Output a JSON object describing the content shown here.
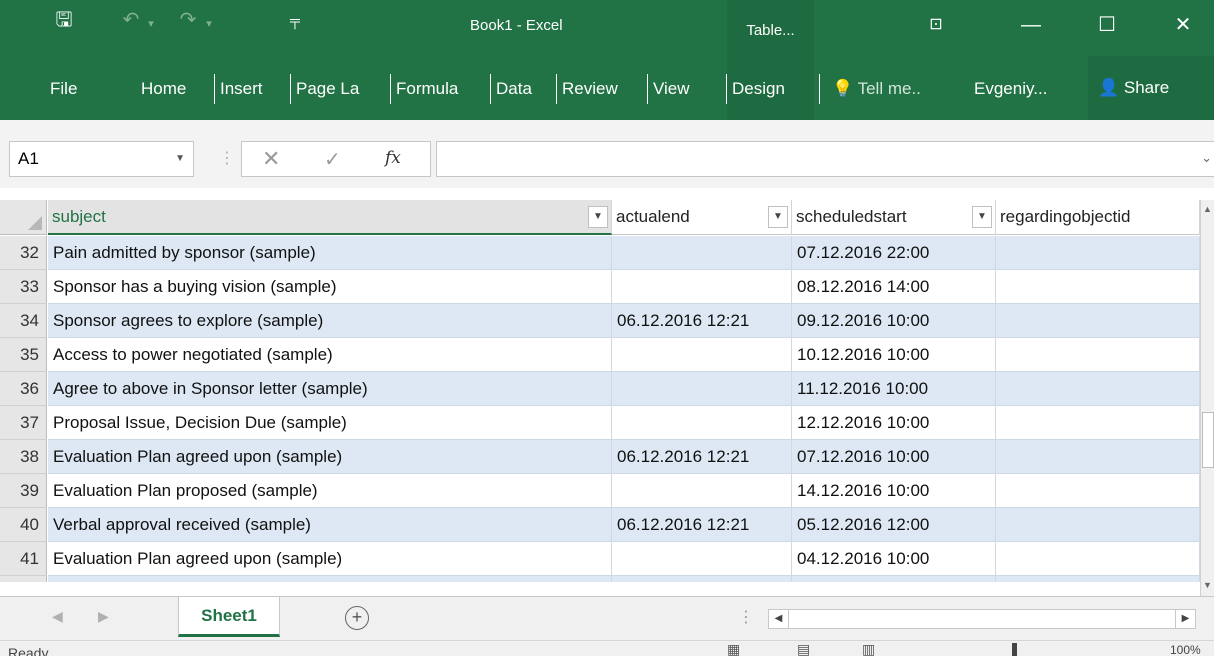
{
  "window": {
    "title": "Book1 - Excel",
    "context_tab": "Table...",
    "controls": {
      "ribbon_display": "⊡",
      "minimize": "—",
      "maximize": "☐",
      "close": "✕"
    }
  },
  "quick_access": {
    "save": "🖫",
    "undo": "↶",
    "redo": "↷",
    "dropdown": "▾",
    "customize": "╤"
  },
  "ribbon": {
    "tabs": [
      "File",
      "Home",
      "Insert",
      "Page La",
      "Formula",
      "Data",
      "Review",
      "View",
      "Design"
    ],
    "tell_me": "Tell me..",
    "account": "Evgeniy...",
    "share": "Share"
  },
  "formula_bar": {
    "name_box": "A1",
    "cancel": "✕",
    "enter": "✓",
    "fx": "fx",
    "value": ""
  },
  "grid": {
    "headers": [
      "subject",
      "actualend",
      "scheduledstart",
      "regardingobjectid"
    ],
    "rows": [
      {
        "num": "32",
        "subject": "Pain admitted by sponsor (sample)",
        "actualend": "",
        "scheduledstart": "07.12.2016 22:00",
        "regardingobjectid": ""
      },
      {
        "num": "33",
        "subject": "Sponsor has a buying vision (sample)",
        "actualend": "",
        "scheduledstart": "08.12.2016 14:00",
        "regardingobjectid": ""
      },
      {
        "num": "34",
        "subject": "Sponsor agrees to explore (sample)",
        "actualend": "06.12.2016 12:21",
        "scheduledstart": "09.12.2016 10:00",
        "regardingobjectid": ""
      },
      {
        "num": "35",
        "subject": "Access to power negotiated (sample)",
        "actualend": "",
        "scheduledstart": "10.12.2016 10:00",
        "regardingobjectid": ""
      },
      {
        "num": "36",
        "subject": "Agree to above in Sponsor letter (sample)",
        "actualend": "",
        "scheduledstart": "11.12.2016 10:00",
        "regardingobjectid": ""
      },
      {
        "num": "37",
        "subject": "Proposal Issue, Decision Due (sample)",
        "actualend": "",
        "scheduledstart": "12.12.2016 10:00",
        "regardingobjectid": ""
      },
      {
        "num": "38",
        "subject": "Evaluation Plan agreed upon (sample)",
        "actualend": "06.12.2016 12:21",
        "scheduledstart": "07.12.2016 10:00",
        "regardingobjectid": ""
      },
      {
        "num": "39",
        "subject": "Evaluation Plan proposed (sample)",
        "actualend": "",
        "scheduledstart": "14.12.2016 10:00",
        "regardingobjectid": ""
      },
      {
        "num": "40",
        "subject": "Verbal approval received (sample)",
        "actualend": "06.12.2016 12:21",
        "scheduledstart": "05.12.2016 12:00",
        "regardingobjectid": ""
      },
      {
        "num": "41",
        "subject": "Evaluation Plan agreed upon (sample)",
        "actualend": "",
        "scheduledstart": "04.12.2016 10:00",
        "regardingobjectid": ""
      }
    ]
  },
  "sheets": {
    "active": "Sheet1",
    "add": "+"
  },
  "status": {
    "text": "Ready",
    "zoom": "100%"
  },
  "colors": {
    "accent": "#217346",
    "band": "#dde8f4"
  }
}
